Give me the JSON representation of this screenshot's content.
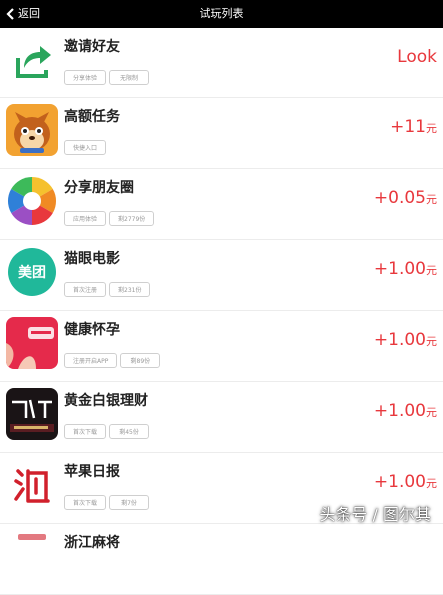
{
  "header": {
    "back_label": "返回",
    "title": "试玩列表"
  },
  "tasks": [
    {
      "name": "邀请好友",
      "tags": [
        "分享体验",
        "无限制"
      ],
      "reward_amount": "Look",
      "reward_unit": "",
      "icon": "share-arrow-icon"
    },
    {
      "name": "高额任务",
      "tags": [
        "快捷入口"
      ],
      "reward_amount": "+11",
      "reward_unit": "元",
      "icon": "squirrel-icon"
    },
    {
      "name": "分享朋友圈",
      "tags": [
        "应用体验",
        "剩2779份"
      ],
      "reward_amount": "+0.05",
      "reward_unit": "元",
      "icon": "aperture-icon"
    },
    {
      "name": "猫眼电影",
      "tags": [
        "首次注册",
        "剩231份"
      ],
      "reward_amount": "+1.00",
      "reward_unit": "元",
      "icon": "meituan-icon",
      "icon_text": "美团"
    },
    {
      "name": "健康怀孕",
      "tags": [
        "注册开启APP",
        "剩89份"
      ],
      "reward_amount": "+1.00",
      "reward_unit": "元",
      "icon": "huggies-icon"
    },
    {
      "name": "黄金白银理财",
      "tags": [
        "首次下载",
        "剩45份"
      ],
      "reward_amount": "+1.00",
      "reward_unit": "元",
      "icon": "finance-icon"
    },
    {
      "name": "苹果日报",
      "tags": [
        "首次下载",
        "剩7份"
      ],
      "reward_amount": "+1.00",
      "reward_unit": "元",
      "icon": "zhe-calligraphy-icon"
    },
    {
      "name": "浙江麻将",
      "tags": [],
      "reward_amount": "",
      "reward_unit": "",
      "icon": "mahjong-icon"
    }
  ],
  "watermark": "头条号 / 图尔其",
  "colors": {
    "accent_red": "#e8383d",
    "top_bar": "#000000",
    "tag_border": "#cfcfcf"
  }
}
